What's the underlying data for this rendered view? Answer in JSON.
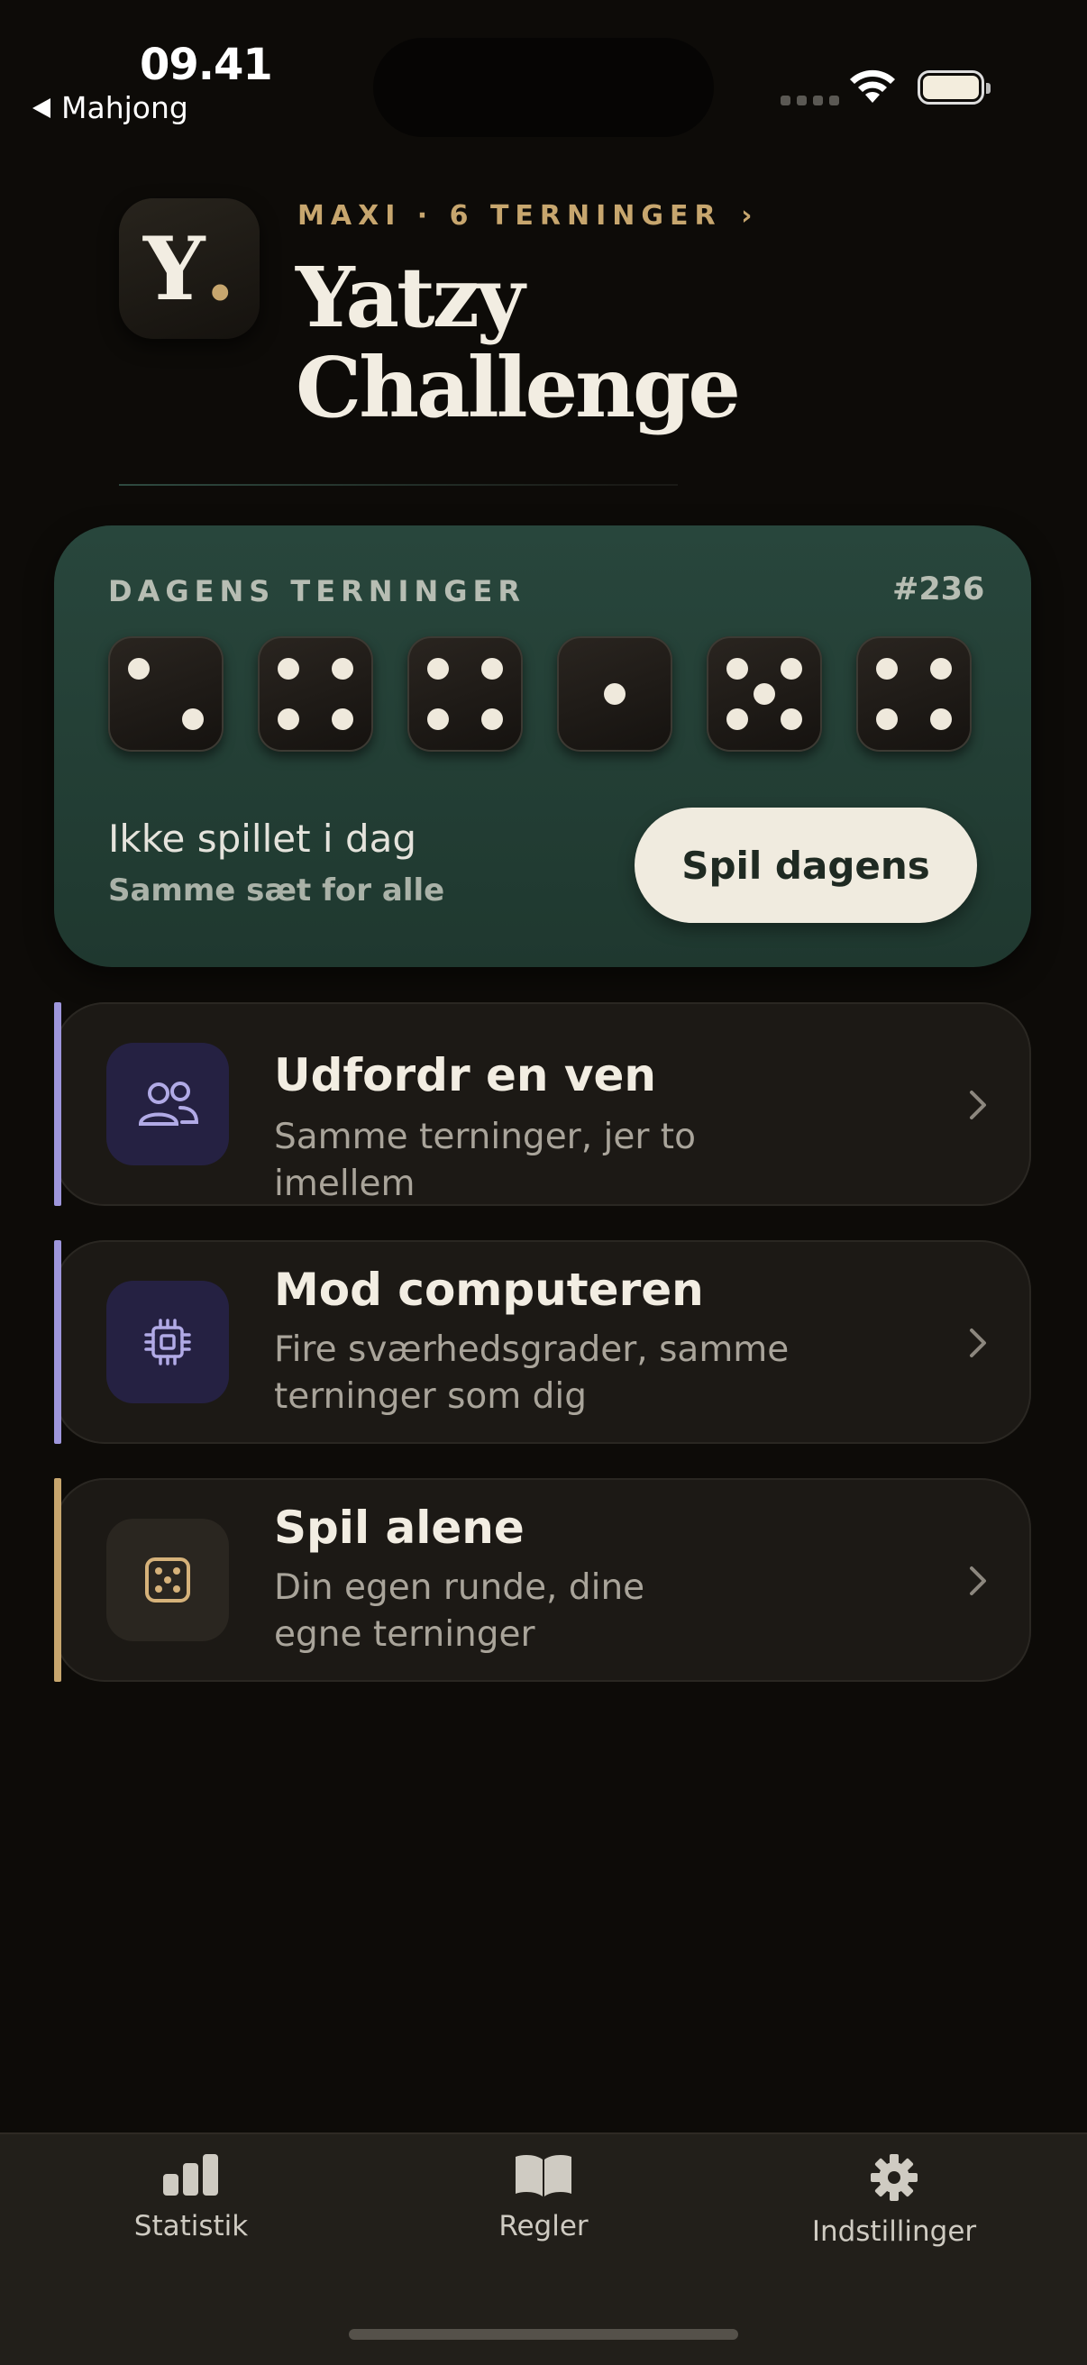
{
  "status_bar": {
    "time": "09.41",
    "back_label": "Mahjong"
  },
  "header": {
    "logo_letter": "Y",
    "logo_dot": ".",
    "kicker": "MAXI · 6 TERNINGER",
    "kicker_chevron": "›",
    "title_line1": "Yatzy",
    "title_line2": "Challenge"
  },
  "daily": {
    "label": "DAGENS TERNINGER",
    "number": "#236",
    "dice": [
      2,
      4,
      4,
      1,
      5,
      4
    ],
    "status": "Ikke spillet i dag",
    "status_sub": "Samme sæt for alle",
    "button_label": "Spil dagens"
  },
  "modes": [
    {
      "title": "Udfordr en ven",
      "subtitle": "Samme terninger, jer to imellem",
      "icon": "users-icon",
      "accent": "#9e96dc"
    },
    {
      "title": "Mod computeren",
      "subtitle": "Fire sværhedsgrader, samme terninger som dig",
      "icon": "chip-icon",
      "accent": "#9e96dc"
    },
    {
      "title": "Spil alene",
      "subtitle": "Din egen runde, dine egne terninger",
      "icon": "dice-icon",
      "accent": "#c7a66e"
    }
  ],
  "tabs": [
    {
      "label": "Statistik",
      "icon": "bar-chart-icon"
    },
    {
      "label": "Regler",
      "icon": "book-icon"
    },
    {
      "label": "Indstillinger",
      "icon": "gear-icon"
    }
  ],
  "colors": {
    "accent_gold": "#c7a66e",
    "accent_purple": "#9e96dc",
    "card_green": "#28463c"
  }
}
